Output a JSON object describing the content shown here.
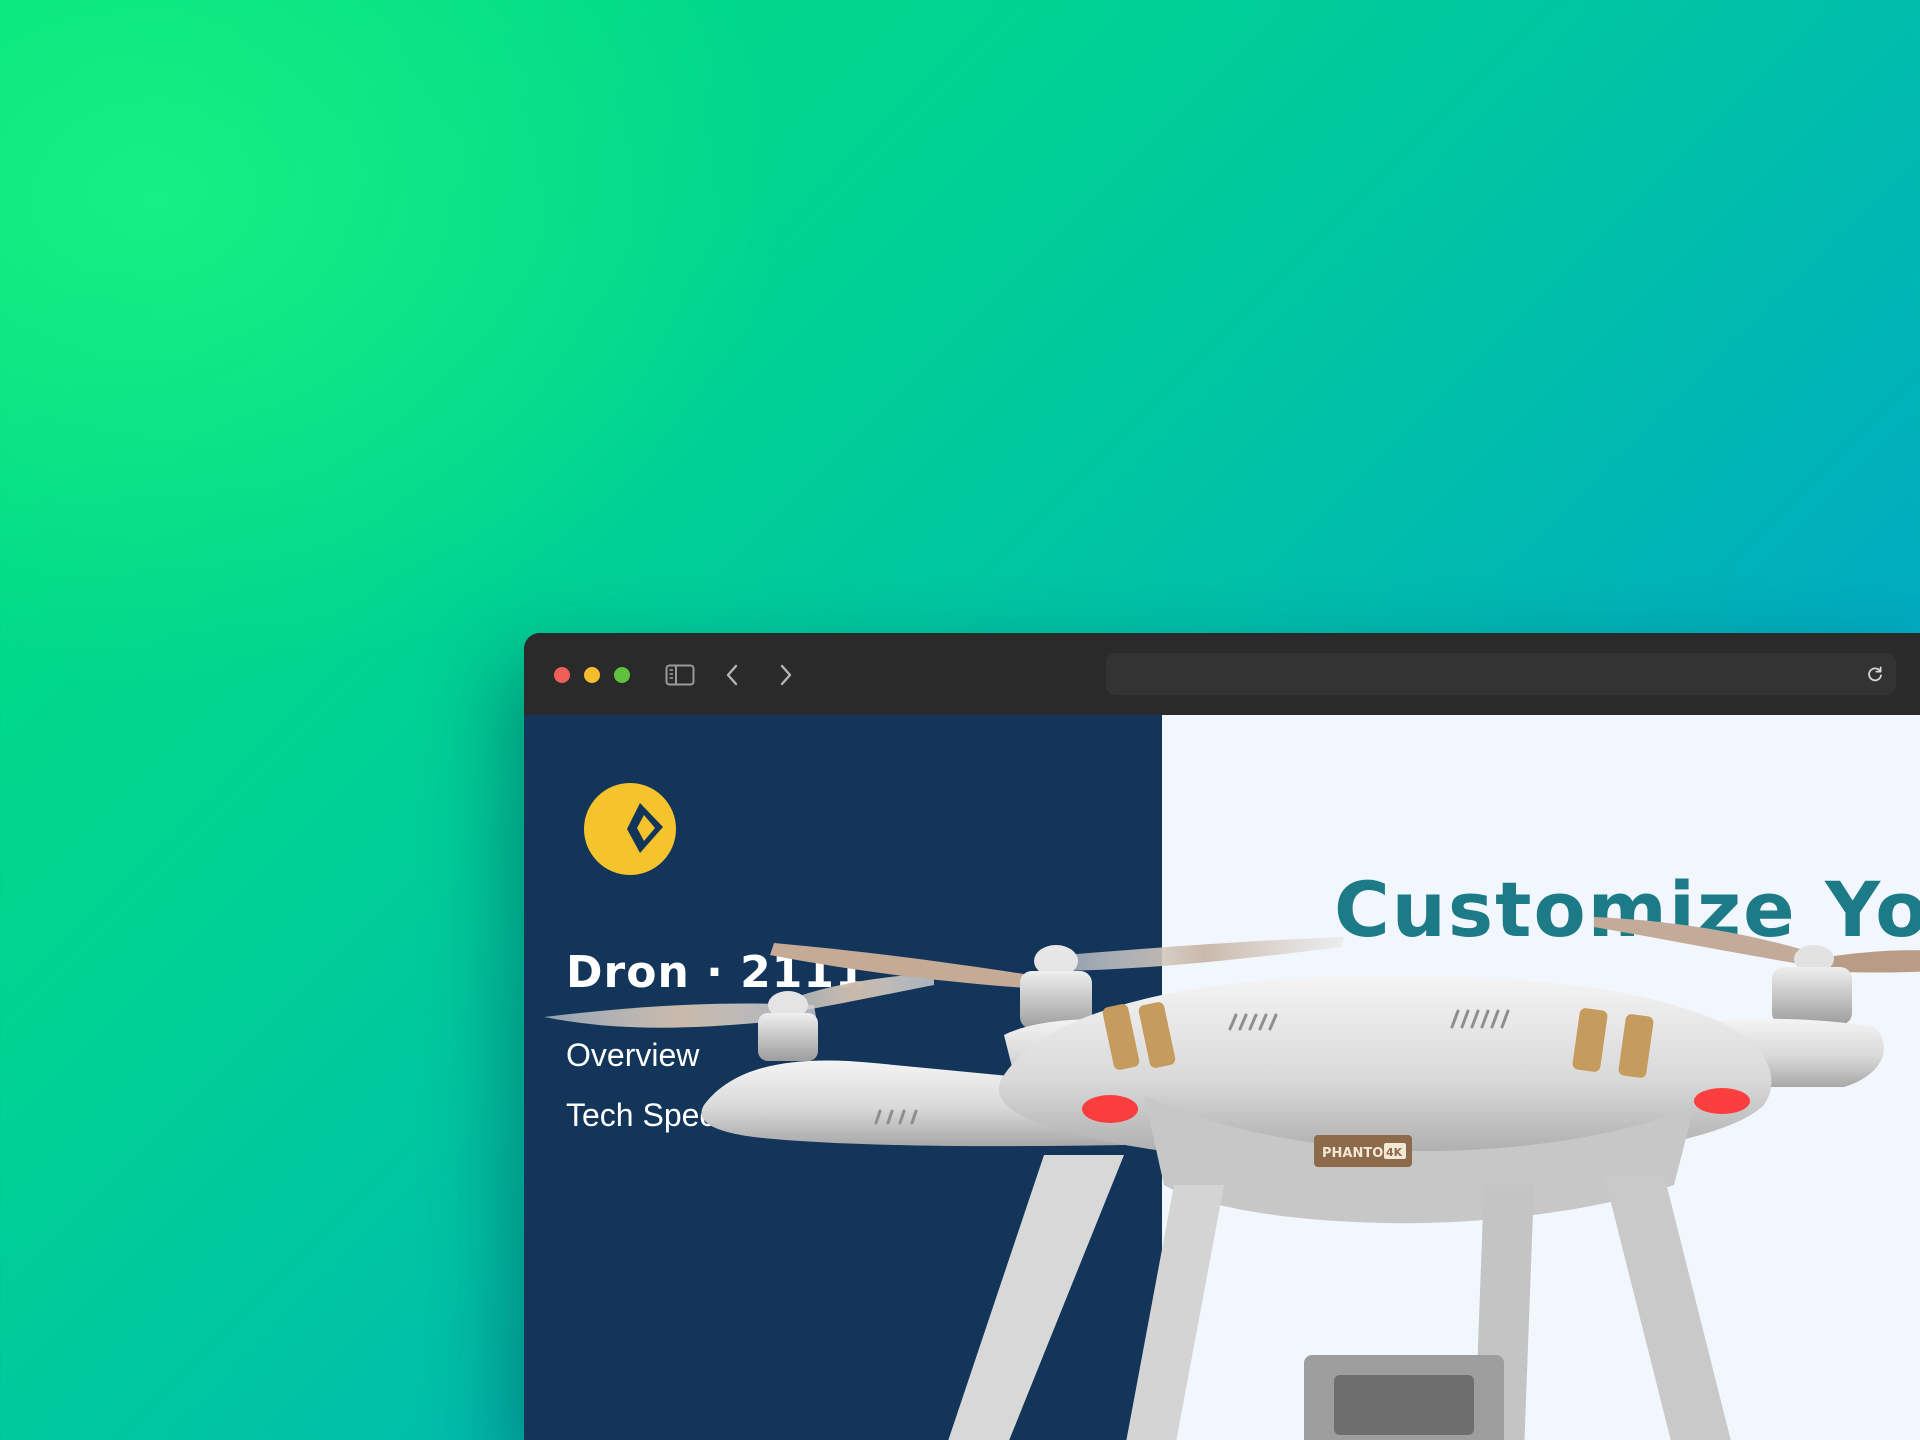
{
  "window": {
    "address": "",
    "controls": [
      "close",
      "minimize",
      "maximize"
    ],
    "toolbar_icons": [
      "sidebar-icon",
      "chevron-left-icon",
      "chevron-right-icon",
      "reload-icon"
    ]
  },
  "sidebar": {
    "logo_icon": "brand-logo-icon",
    "brand_title": "Dron · 2111",
    "nav": [
      {
        "label": "Overview"
      },
      {
        "label": "Tech Specs"
      }
    ]
  },
  "hero": {
    "heading": "Customize You",
    "image": "drone-image",
    "drone_badge": "PHANTOM",
    "drone_badge_suffix": "4K"
  },
  "colors": {
    "sidebar_bg": "#13355a",
    "content_bg": "#f2f6fd",
    "heading": "#1c7b86",
    "logo": "#f5c42c",
    "background_start": "#00e07e",
    "background_end": "#009bc9"
  }
}
